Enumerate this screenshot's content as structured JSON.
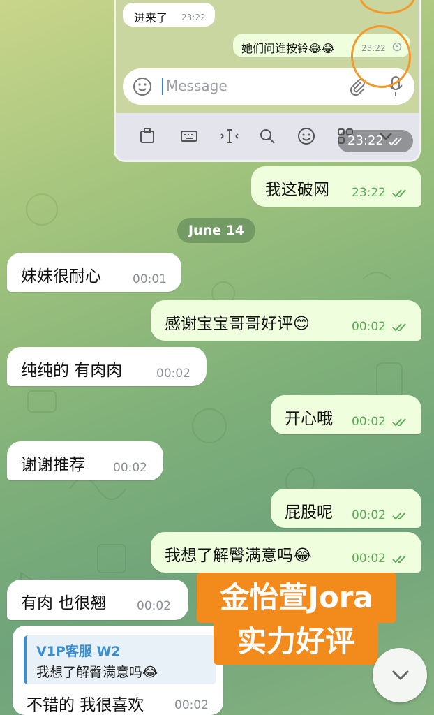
{
  "embedded_screenshot": {
    "messages": [
      {
        "text": "进来了",
        "time": "23:22",
        "dir": "in"
      },
      {
        "text": "她们问谁按铃😂😂",
        "time": "23:22",
        "dir": "out"
      }
    ],
    "input_placeholder": "Message",
    "overlay_time": "23:22"
  },
  "chat": {
    "messages": [
      {
        "text": "我这破网",
        "time": "23:22"
      },
      {
        "text": "妹妹很耐心",
        "time": "00:01"
      },
      {
        "text": "感谢宝宝哥哥好评😊",
        "time": "00:02"
      },
      {
        "text": "纯纯的 有肉肉",
        "time": "00:02"
      },
      {
        "text": "开心哦",
        "time": "00:02"
      },
      {
        "text": "谢谢推荐",
        "time": "00:02"
      },
      {
        "text": "屁股呢",
        "time": "00:02"
      },
      {
        "text": "我想了解臀满意吗😂",
        "time": "00:02"
      },
      {
        "text": "有肉 也很翘",
        "time": "00:02"
      },
      {
        "text": "不错的 我很喜欢",
        "time": "00:02"
      }
    ],
    "date_divider": "June 14",
    "reply": {
      "author": "V1P客服 W2",
      "quoted": "我想了解臀满意吗😂"
    }
  },
  "promo": {
    "line1": "金怡萱Jora",
    "line2": "实力好评"
  },
  "colors": {
    "incoming": "#ffffff",
    "outgoing": "#effedd",
    "check": "#5bab55",
    "promo": "#f28a1c"
  }
}
